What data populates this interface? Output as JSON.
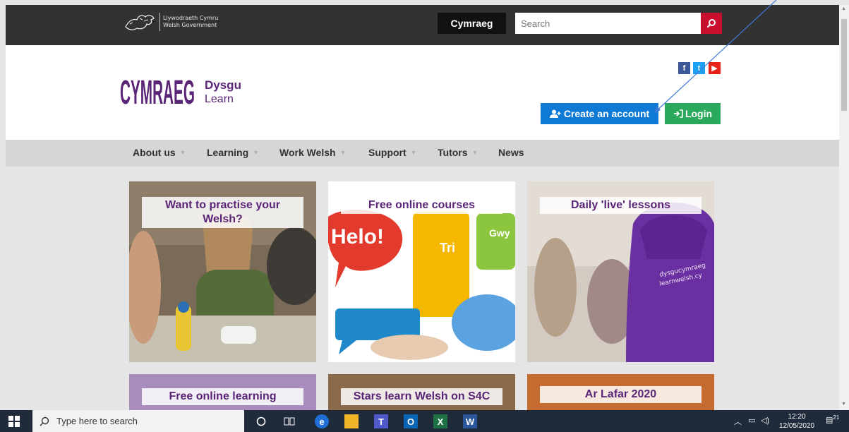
{
  "gov": {
    "line1": "Llywodraeth Cymru",
    "line2": "Welsh Government",
    "language_button": "Cymraeg",
    "search_placeholder": "Search"
  },
  "brand": {
    "logo_word": "CYMRAEG",
    "line1": "Dysgu",
    "line2": "Learn"
  },
  "account": {
    "create_label": "Create an account",
    "login_label": "Login"
  },
  "social": {
    "facebook": "f",
    "twitter": "t",
    "youtube": "▶"
  },
  "nav": [
    {
      "label": "About us"
    },
    {
      "label": "Learning"
    },
    {
      "label": "Work Welsh"
    },
    {
      "label": "Support"
    },
    {
      "label": "Tutors"
    },
    {
      "label": "News"
    }
  ],
  "tiles": [
    {
      "title": "Want to practise your Welsh?"
    },
    {
      "title": "Free online courses",
      "words": [
        "Helo!",
        "Tri",
        "Gwy"
      ]
    },
    {
      "title": "Daily 'live' lessons",
      "hoodie": [
        "dysgucymraeg",
        "learnwelsh.cy"
      ]
    },
    {
      "title": "Free online learning"
    },
    {
      "title": "Stars learn Welsh on S4C"
    },
    {
      "title": "Ar Lafar 2020"
    }
  ],
  "taskbar": {
    "search_placeholder": "Type here to search",
    "time": "12:20",
    "date": "12/05/2020",
    "notifications": "21"
  },
  "colors": {
    "brand_purple": "#5a2577",
    "gov_bar": "#323232",
    "search_red": "#c8102e",
    "create_blue": "#0f7ad6",
    "login_green": "#2aa85b"
  }
}
